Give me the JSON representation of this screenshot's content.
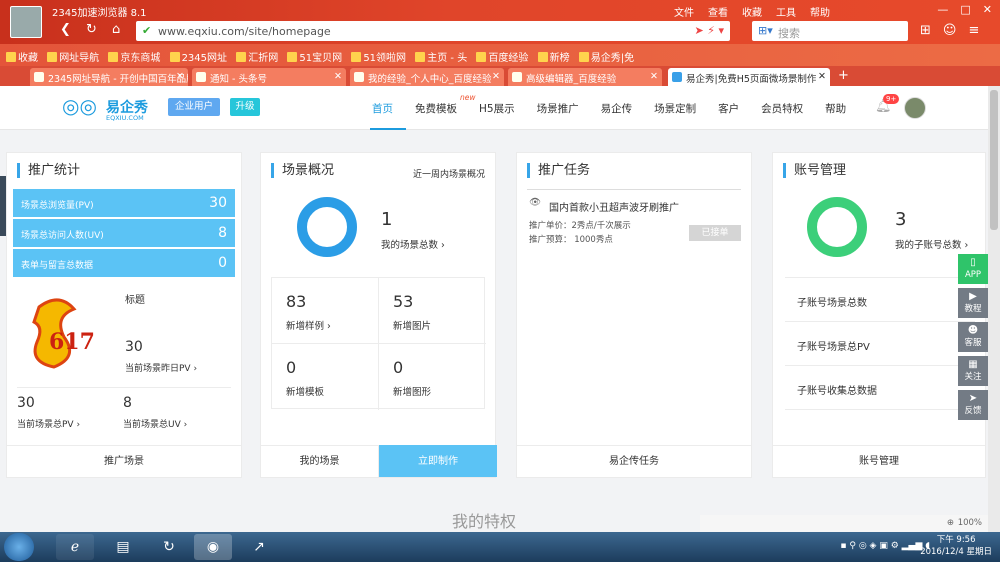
{
  "browser": {
    "title": "2345加速浏览器 8.1",
    "menu": [
      "文件",
      "查看",
      "收藏",
      "工具",
      "帮助"
    ],
    "url": "www.eqxiu.com/site/homepage",
    "search_placeholder": "搜索",
    "bookmarks": [
      "收藏",
      "网址导航",
      "京东商城",
      "2345网址",
      "汇折网",
      "51宝贝网",
      "51领啦网",
      "主页 - 头",
      "百度经验",
      "新榜",
      "易企秀|免"
    ],
    "tabs": [
      {
        "label": "2345网址导航 - 开创中国百年品牌",
        "active": false
      },
      {
        "label": "通知 - 头条号",
        "active": false
      },
      {
        "label": "我的经验_个人中心_百度经验",
        "active": false
      },
      {
        "label": "高级编辑器_百度经验",
        "active": false
      },
      {
        "label": "易企秀|免费H5页面微场景制作",
        "active": true
      }
    ]
  },
  "header": {
    "logo_cn": "易企秀",
    "logo_en": "EQXIU.COM",
    "enterprise_btn": "企业用户",
    "upgrade_btn": "升级",
    "nav": [
      "首页",
      "免费模板",
      "H5展示",
      "场景推广",
      "易企传",
      "场景定制",
      "客户",
      "会员特权",
      "帮助"
    ],
    "nav_new_badge": "new",
    "notif_badge": "9+"
  },
  "promo_stats": {
    "title": "推广统计",
    "rows": [
      {
        "label": "场景总浏览量(PV)",
        "value": "30"
      },
      {
        "label": "场景总访问人数(UV)",
        "value": "8"
      },
      {
        "label": "表单与留言总数据",
        "value": "0"
      }
    ],
    "thumb_title": "标题",
    "yesterday_pv": "30",
    "yesterday_pv_label": "当前场景昨日PV",
    "total_pv": "30",
    "total_pv_label": "当前场景总PV",
    "total_uv": "8",
    "total_uv_label": "当前场景总UV",
    "footer": "推广场景"
  },
  "scene_overview": {
    "title": "场景概况",
    "link": "近一周内场景概况",
    "count": "1",
    "count_label": "我的场景总数",
    "grid": [
      {
        "value": "83",
        "label": "新增样例"
      },
      {
        "value": "53",
        "label": "新增图片"
      },
      {
        "value": "0",
        "label": "新增模板"
      },
      {
        "value": "0",
        "label": "新增图形"
      }
    ],
    "footer_left": "我的场景",
    "footer_right": "立即制作"
  },
  "promo_task": {
    "title": "推广任务",
    "task_name": "国内首款小丑超声波牙刷推广",
    "unit_price": "推广单价：2秀点/千次展示",
    "budget": "推广预算： 1000秀点",
    "status_btn": "已接单",
    "footer": "易企传任务"
  },
  "account": {
    "title": "账号管理",
    "count": "3",
    "count_label": "我的子账号总数",
    "rows": [
      "子账号场景总数",
      "子账号场景总PV",
      "子账号收集总数据"
    ],
    "footer": "账号管理"
  },
  "side_float": [
    {
      "label": "APP",
      "icon": "phone-icon"
    },
    {
      "label": "教程",
      "icon": "play-icon"
    },
    {
      "label": "客服",
      "icon": "user-icon"
    },
    {
      "label": "关注",
      "icon": "qr-icon"
    },
    {
      "label": "反馈",
      "icon": "send-icon"
    }
  ],
  "next_section": "我的特权",
  "statusbar": {
    "zoom": "100%"
  },
  "taskbar": {
    "time": "下午 9:56",
    "date": "2016/12/4 星期日"
  },
  "colors": {
    "brand": "#1c9bde",
    "stat_row": "#5bc3f5",
    "ring_blue": "#2b9de6",
    "ring_green": "#3ccf7a",
    "make_btn": "#5bc3f5"
  }
}
